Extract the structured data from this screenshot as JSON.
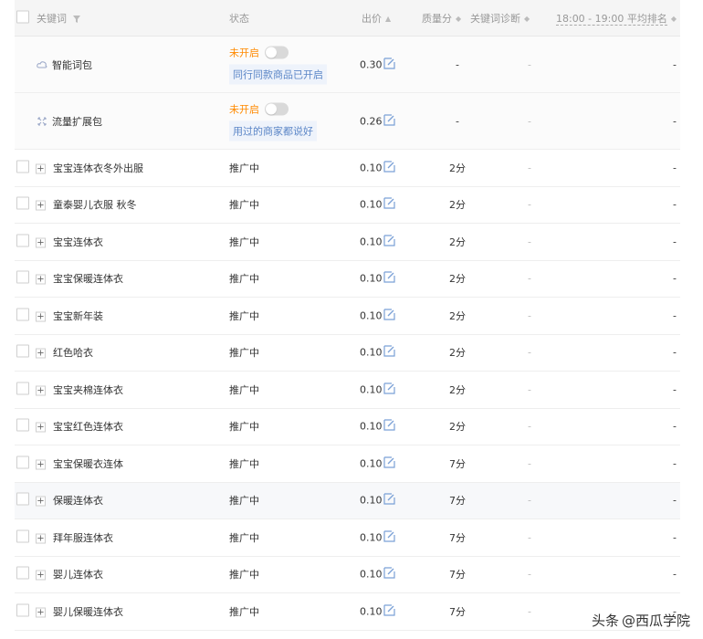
{
  "header": {
    "keyword": "关键词",
    "status": "状态",
    "bid": "出价",
    "quality": "质量分",
    "diagnosis": "关键词诊断",
    "rank": "18:00 - 19:00 平均排名"
  },
  "packages": [
    {
      "name": "智能词包",
      "status": "未开启",
      "tip": "同行同款商品已开启",
      "bid": "0.30",
      "quality": "-",
      "diag": "-",
      "rank": "-"
    },
    {
      "name": "流量扩展包",
      "status": "未开启",
      "tip": "用过的商家都说好",
      "bid": "0.26",
      "quality": "-",
      "diag": "-",
      "rank": "-"
    }
  ],
  "rows": [
    {
      "keyword": "宝宝连体衣冬外出服",
      "status": "推广中",
      "bid": "0.10",
      "quality": "2分",
      "diag": "-",
      "rank": "-"
    },
    {
      "keyword": "童泰婴儿衣服 秋冬",
      "status": "推广中",
      "bid": "0.10",
      "quality": "2分",
      "diag": "-",
      "rank": "-"
    },
    {
      "keyword": "宝宝连体衣",
      "status": "推广中",
      "bid": "0.10",
      "quality": "2分",
      "diag": "-",
      "rank": "-"
    },
    {
      "keyword": "宝宝保暖连体衣",
      "status": "推广中",
      "bid": "0.10",
      "quality": "2分",
      "diag": "-",
      "rank": "-"
    },
    {
      "keyword": "宝宝新年装",
      "status": "推广中",
      "bid": "0.10",
      "quality": "2分",
      "diag": "-",
      "rank": "-"
    },
    {
      "keyword": "红色哈衣",
      "status": "推广中",
      "bid": "0.10",
      "quality": "2分",
      "diag": "-",
      "rank": "-"
    },
    {
      "keyword": "宝宝夹棉连体衣",
      "status": "推广中",
      "bid": "0.10",
      "quality": "2分",
      "diag": "-",
      "rank": "-"
    },
    {
      "keyword": "宝宝红色连体衣",
      "status": "推广中",
      "bid": "0.10",
      "quality": "2分",
      "diag": "-",
      "rank": "-"
    },
    {
      "keyword": "宝宝保暖衣连体",
      "status": "推广中",
      "bid": "0.10",
      "quality": "7分",
      "diag": "-",
      "rank": "-"
    },
    {
      "keyword": "保暖连体衣",
      "status": "推广中",
      "bid": "0.10",
      "quality": "7分",
      "diag": "-",
      "rank": "-"
    },
    {
      "keyword": "拜年服连体衣",
      "status": "推广中",
      "bid": "0.10",
      "quality": "7分",
      "diag": "-",
      "rank": "-"
    },
    {
      "keyword": "婴儿连体衣",
      "status": "推广中",
      "bid": "0.10",
      "quality": "7分",
      "diag": "-",
      "rank": "-"
    },
    {
      "keyword": "婴儿保暖连体衣",
      "status": "推广中",
      "bid": "0.10",
      "quality": "7分",
      "diag": "-",
      "rank": "-"
    }
  ],
  "watermark": {
    "prefix": "头条",
    "at": "@西瓜学院"
  },
  "colors": {
    "status_off": "#ff8a00",
    "tip_text": "#5b86c7",
    "tip_bg": "#eef3fb",
    "header_bg": "#f5f5f5"
  }
}
